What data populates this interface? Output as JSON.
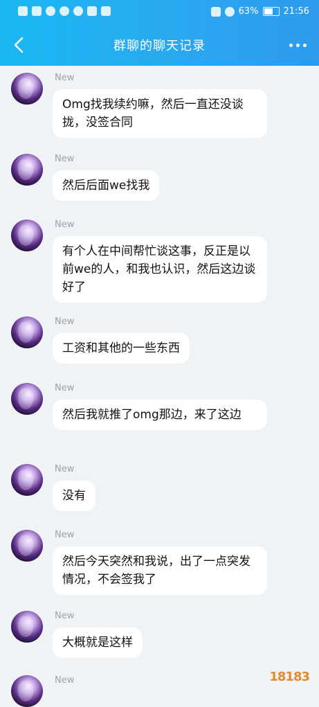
{
  "status_bar": {
    "battery_percent": "63%",
    "time": "21:56"
  },
  "header": {
    "title": "群聊的聊天记录"
  },
  "messages": [
    {
      "sender": "New",
      "text": "Omg找我续约嘛，然后一直还没谈拢，没签合同"
    },
    {
      "sender": "New",
      "text": "然后后面we找我"
    },
    {
      "sender": "New",
      "text": "有个人在中间帮忙谈这事，反正是以前we的人，和我也认识，然后这边谈好了"
    },
    {
      "sender": "New",
      "text": "工资和其他的一些东西"
    },
    {
      "sender": "New",
      "text": "然后我就推了omg那边，来了这边"
    },
    {
      "sender": "New",
      "text": "没有"
    },
    {
      "sender": "New",
      "text": "然后今天突然和我说，出了一点突发情况，不会签我了"
    },
    {
      "sender": "New",
      "text": "大概就是这样"
    },
    {
      "sender": "New",
      "text": ""
    }
  ],
  "watermark": {
    "text": "18183"
  }
}
